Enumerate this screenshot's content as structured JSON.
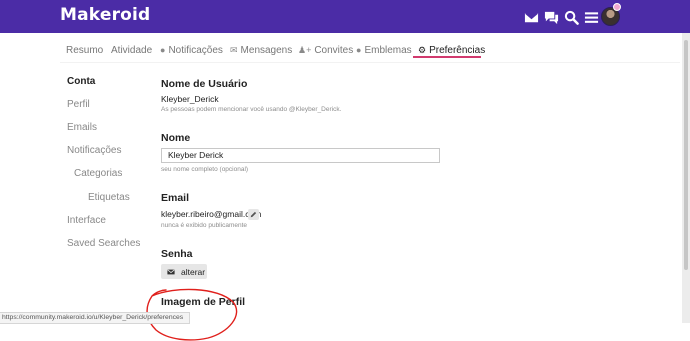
{
  "header": {
    "logo": "Makeroid",
    "icons": [
      "envelope-icon",
      "chat-icon",
      "search-icon",
      "menu-icon"
    ],
    "bg_color": "#4b2ca6"
  },
  "tabs": [
    {
      "label": "Resumo",
      "icon": ""
    },
    {
      "label": "Atividade",
      "icon": ""
    },
    {
      "label": "Notificações",
      "icon": "comment-icon"
    },
    {
      "label": "Mensagens",
      "icon": "envelope-icon"
    },
    {
      "label": "Convites",
      "icon": "user-plus-icon"
    },
    {
      "label": "Emblemas",
      "icon": "badge-icon"
    },
    {
      "label": "Preferências",
      "icon": "gear-icon",
      "active": true
    }
  ],
  "sidebar": {
    "items": [
      {
        "label": "Conta"
      },
      {
        "label": "Perfil"
      },
      {
        "label": "Emails"
      },
      {
        "label": "Notificações"
      },
      {
        "label": "Categorias"
      },
      {
        "label": "Etiquetas"
      },
      {
        "label": "Interface"
      },
      {
        "label": "Saved Searches"
      }
    ]
  },
  "main": {
    "username": {
      "title": "Nome de Usuário",
      "value": "Kleyber_Derick",
      "help": "As pessoas podem mencionar você usando @Kleyber_Derick."
    },
    "name": {
      "title": "Nome",
      "value": "Kleyber Derick",
      "help": "seu nome completo (opcional)"
    },
    "email": {
      "title": "Email",
      "value": "kleyber.ribeiro@gmail.com",
      "help": "nunca é exibido publicamente"
    },
    "password": {
      "title": "Senha",
      "button": "alterar"
    },
    "profile_image": {
      "title": "Imagem de Perfil"
    }
  },
  "status_url": "https://community.makeroid.io/u/Kleyber_Derick/preferences",
  "colors": {
    "accent": "#d13a6e",
    "annotation": "#e0201c"
  }
}
